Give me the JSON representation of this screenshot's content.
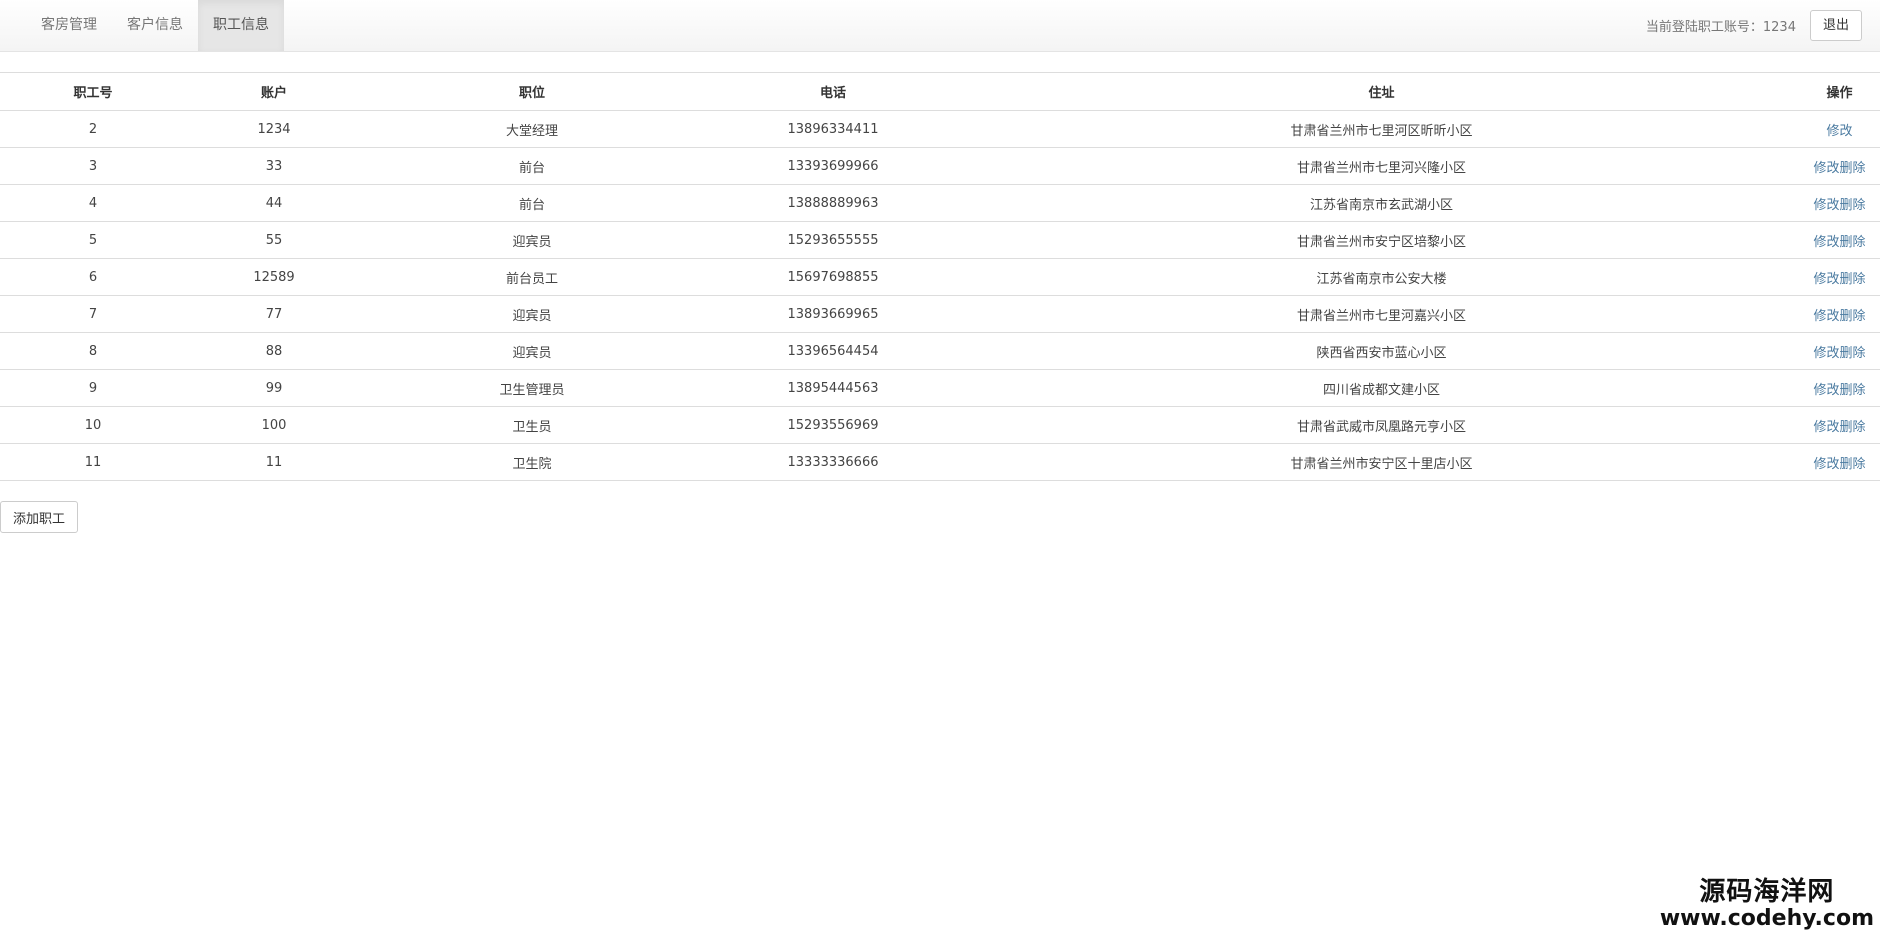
{
  "nav": {
    "tabs": [
      {
        "label": "客房管理",
        "active": false
      },
      {
        "label": "客户信息",
        "active": false
      },
      {
        "label": "职工信息",
        "active": true
      }
    ],
    "login_label": "当前登陆职工账号：",
    "login_account": "1234",
    "logout_label": "退出"
  },
  "table": {
    "headers": [
      "职工号",
      "账户",
      "职位",
      "电话",
      "住址",
      "操作"
    ],
    "rows": [
      {
        "id": "2",
        "account": "1234",
        "position": "大堂经理",
        "phone": "13896334411",
        "address": "甘肃省兰州市七里河区昕昕小区",
        "actions": [
          "修改"
        ]
      },
      {
        "id": "3",
        "account": "33",
        "position": "前台",
        "phone": "13393699966",
        "address": "甘肃省兰州市七里河兴隆小区",
        "actions": [
          "修改",
          "删除"
        ]
      },
      {
        "id": "4",
        "account": "44",
        "position": "前台",
        "phone": "13888889963",
        "address": "江苏省南京市玄武湖小区",
        "actions": [
          "修改",
          "删除"
        ]
      },
      {
        "id": "5",
        "account": "55",
        "position": "迎宾员",
        "phone": "15293655555",
        "address": "甘肃省兰州市安宁区培黎小区",
        "actions": [
          "修改",
          "删除"
        ]
      },
      {
        "id": "6",
        "account": "12589",
        "position": "前台员工",
        "phone": "15697698855",
        "address": "江苏省南京市公安大楼",
        "actions": [
          "修改",
          "删除"
        ]
      },
      {
        "id": "7",
        "account": "77",
        "position": "迎宾员",
        "phone": "13893669965",
        "address": "甘肃省兰州市七里河嘉兴小区",
        "actions": [
          "修改",
          "删除"
        ]
      },
      {
        "id": "8",
        "account": "88",
        "position": "迎宾员",
        "phone": "13396564454",
        "address": "陕西省西安市蓝心小区",
        "actions": [
          "修改",
          "删除"
        ]
      },
      {
        "id": "9",
        "account": "99",
        "position": "卫生管理员",
        "phone": "13895444563",
        "address": "四川省成都文建小区",
        "actions": [
          "修改",
          "删除"
        ]
      },
      {
        "id": "10",
        "account": "100",
        "position": "卫生员",
        "phone": "15293556969",
        "address": "甘肃省武威市凤凰路元亨小区",
        "actions": [
          "修改",
          "删除"
        ]
      },
      {
        "id": "11",
        "account": "11",
        "position": "卫生院",
        "phone": "13333336666",
        "address": "甘肃省兰州市安宁区十里店小区",
        "actions": [
          "修改",
          "删除"
        ]
      }
    ]
  },
  "add_button_label": "添加职工",
  "watermark": {
    "cn": "源码海洋网",
    "url": "www.codehy.com"
  },
  "colors": {
    "link": "#4a7aa0",
    "active_tab_bg": "#e6e6e6",
    "border": "#dddddd"
  }
}
